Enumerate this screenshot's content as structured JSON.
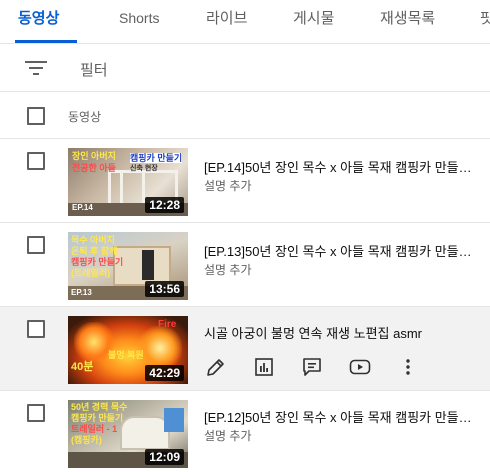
{
  "tabs": [
    {
      "label": "동영상"
    },
    {
      "label": "Shorts"
    },
    {
      "label": "라이브"
    },
    {
      "label": "게시물"
    },
    {
      "label": "재생목록"
    },
    {
      "label": "팟"
    }
  ],
  "filter": {
    "label": "필터"
  },
  "list_header": {
    "label": "동영상"
  },
  "videos": [
    {
      "title": "[EP.14]50년 장인 목수 x 아들 목재 캠핑카 만들…",
      "description": "설명 추가",
      "duration": "12:28",
      "thumb_text": [
        "장인 아버지",
        "전공한 아들",
        "캠핑카 만들기",
        "신축 현장",
        "EP.14"
      ]
    },
    {
      "title": "[EP.13]50년 장인 목수 x 아들 목재 캠핑카 만들…",
      "description": "설명 추가",
      "duration": "13:56",
      "thumb_text": [
        "목수 아버지",
        "은퇴 후 함께",
        "캠핑카 만들기",
        "(트레일러)",
        "EP.13"
      ]
    },
    {
      "title": "시골 아궁이 불멍 연속 재생 노편집 asmr",
      "duration": "42:29",
      "thumb_text": [
        "Fire",
        "40분",
        "불멍 복원"
      ]
    },
    {
      "title": "[EP.12]50년 장인 목수 x 아들 목재 캠핑카 만들…",
      "description": "설명 추가",
      "duration": "12:09",
      "thumb_text": [
        "50년 경력 목수",
        "캠핑카 만들기",
        "트레일러 - 1",
        "(캠핑카)"
      ]
    }
  ],
  "colors": {
    "accent": "#065fd4",
    "text": "#0d0d0d",
    "muted": "#606060",
    "divider": "#e5e5e5"
  }
}
